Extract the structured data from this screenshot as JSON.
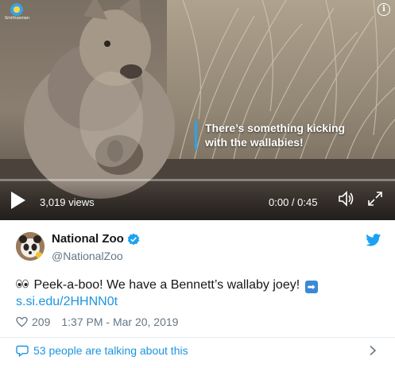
{
  "video": {
    "brand_text": "Smithsonian",
    "caption_line1": "There’s something kicking",
    "caption_line2": "with the wallabies!",
    "views": "3,019 views",
    "time": "0:00 / 0:45",
    "progress_fraction": 0.0
  },
  "author": {
    "name": "National Zoo",
    "handle": "@NationalZoo",
    "verified": true
  },
  "tweet": {
    "text_main": "Peek-a-boo! We have a Bennett’s wallaby joey!",
    "link": "s.si.edu/2HHNN0t",
    "likes": "209",
    "timestamp": "1:37 PM - Mar 20, 2019"
  },
  "footer": {
    "talking": "53 people are talking about this"
  },
  "icons": {
    "play": "play-icon",
    "volume": "volume-icon",
    "fullscreen": "fullscreen-icon",
    "info": "info-icon",
    "verified": "verified-badge-icon",
    "bird": "twitter-bird-icon",
    "heart": "heart-icon",
    "bubble": "speech-bubble-icon",
    "chevron": "chevron-right-icon",
    "eyes": "eyes-emoji-icon",
    "arrow": "right-arrow-emoji-icon"
  },
  "colors": {
    "accent": "#1b95e0",
    "text": "#14171a",
    "muted": "#657786",
    "caption_bar": "#2aa3ef"
  }
}
